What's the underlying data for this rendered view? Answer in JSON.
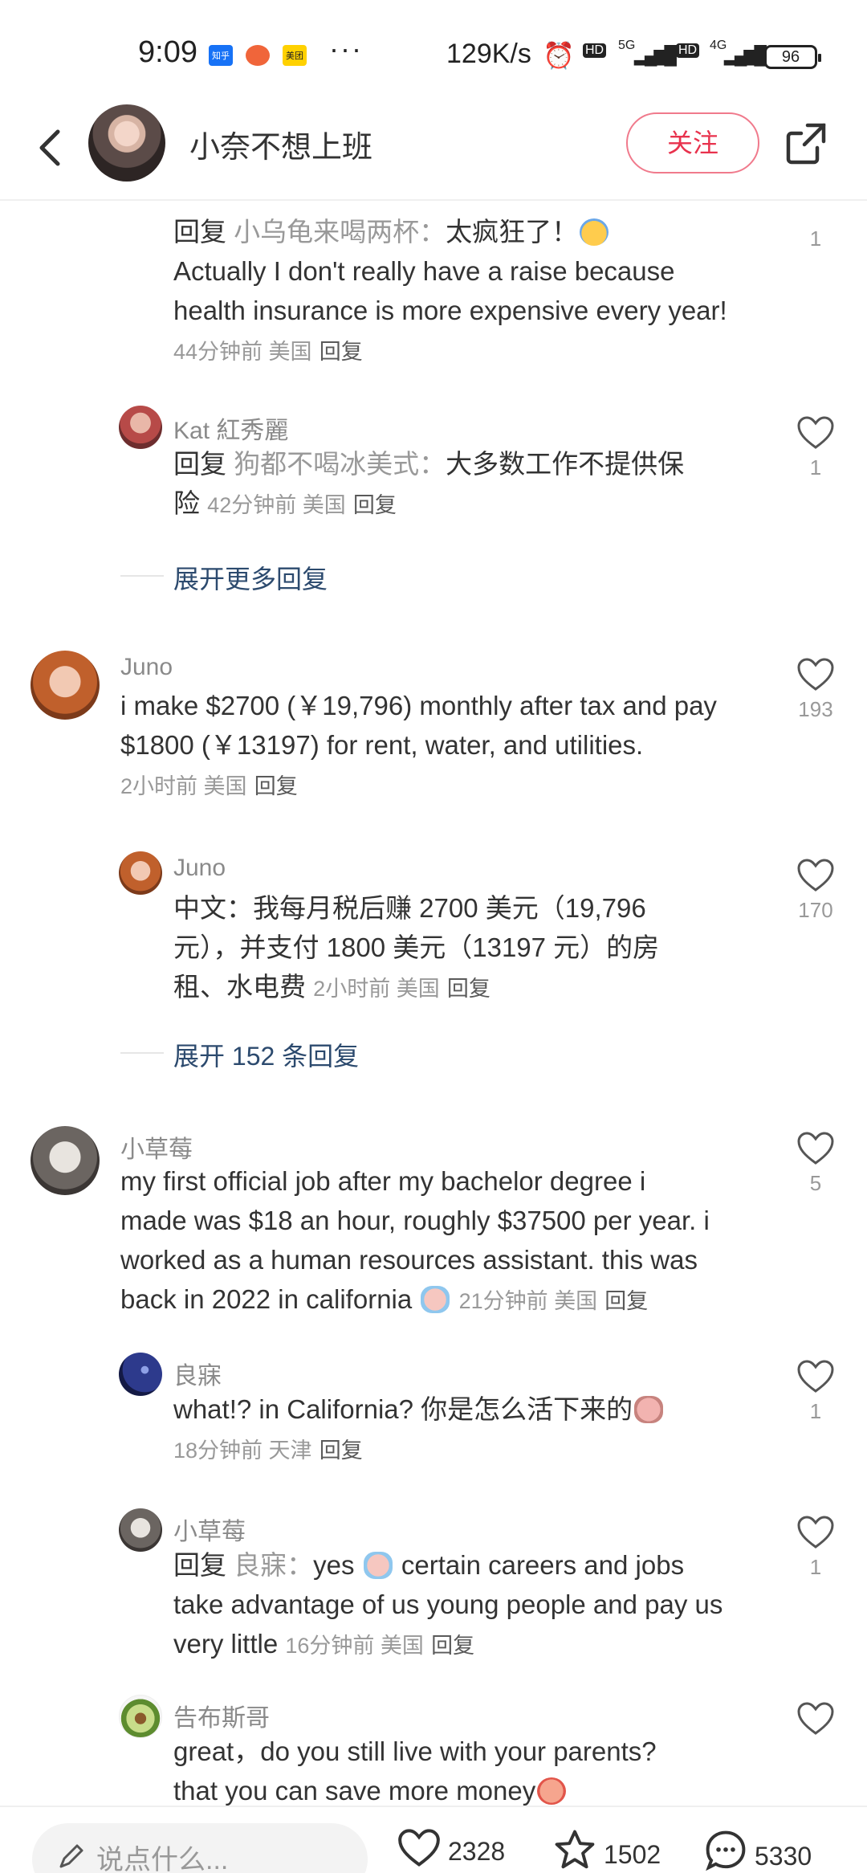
{
  "status_bar": {
    "time": "9:09",
    "app_icons": [
      {
        "label": "知乎",
        "color": "#1772f6"
      },
      {
        "label": "",
        "color": "#f0653a"
      },
      {
        "label": "美团",
        "color": "#ffd100"
      }
    ],
    "more": "···",
    "net_speed": "129K/s",
    "hd1": "HD",
    "sig1": "5G",
    "hd2": "HD",
    "sig2": "4G",
    "battery": "96"
  },
  "header": {
    "name": "小奈不想上班",
    "follow_label": "关注"
  },
  "comments": {
    "c1": {
      "prefix": "回复",
      "target": "小乌龟来喝两杯：",
      "text_cn": "太疯狂了！",
      "line2": "Actually I don't really have a raise because",
      "line3": "health insurance is more expensive every year!",
      "meta": "44分钟前 美国",
      "reply": "回复",
      "likes": "1"
    },
    "c2": {
      "name": "Kat 紅秀麗",
      "prefix": "回复",
      "target": "狗都不喝冰美式：",
      "line1": "大多数工作不提供保",
      "line2": "险",
      "meta": "42分钟前 美国",
      "reply": "回复",
      "likes": "1"
    },
    "expand1": "展开更多回复",
    "c3": {
      "name": "Juno",
      "line1": "i make $2700 (￥19,796) monthly after tax and pay",
      "line2": "$1800 (￥13197) for rent, water, and utilities.",
      "meta": "2小时前 美国",
      "reply": "回复",
      "likes": "193"
    },
    "c4": {
      "name": "Juno",
      "line1": "中文：我每月税后赚 2700 美元（19,796",
      "line2": "元），并支付 1800 美元（13197 元）的房",
      "line3": "租、水电费",
      "meta": "2小时前 美国",
      "reply": "回复",
      "likes": "170"
    },
    "expand2": "展开 152 条回复",
    "c5": {
      "name": "小草莓",
      "line1": "my first official job after my bachelor degree i",
      "line2": "made was $18 an hour, roughly $37500 per year. i",
      "line3": "worked as a human resources assistant. this was",
      "line4": "back in 2022 in california",
      "meta": "21分钟前 美国",
      "reply": "回复",
      "likes": "5"
    },
    "c6": {
      "name": "良寐",
      "line1": "what!? in California? 你是怎么活下来的",
      "meta": "18分钟前 天津",
      "reply": "回复",
      "likes": "1"
    },
    "c7": {
      "name": "小草莓",
      "prefix": "回复",
      "target": "良寐：",
      "line1": "yes",
      "line1b": "certain careers and jobs",
      "line2": "take advantage of us young people and pay us",
      "line3": "very little",
      "meta": "16分钟前 美国",
      "reply": "回复",
      "likes": "1"
    },
    "c8": {
      "name": "告布斯哥",
      "line1": "great，do you still live with your parents?",
      "line2": "that you can save more money"
    }
  },
  "bottom_bar": {
    "placeholder": "说点什么...",
    "likes": "2328",
    "stars": "1502",
    "comments": "5330"
  }
}
